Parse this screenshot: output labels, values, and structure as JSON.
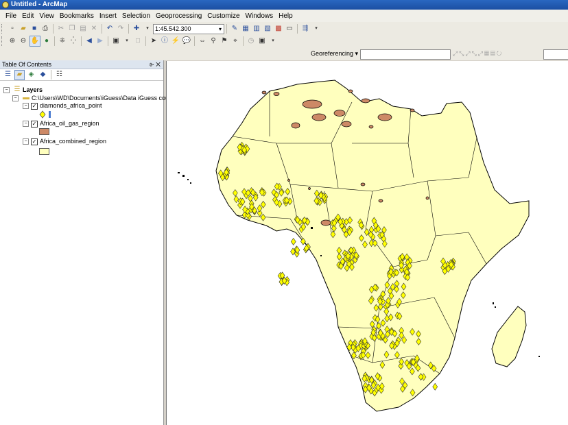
{
  "window": {
    "title": "Untitled - ArcMap"
  },
  "menu": [
    "File",
    "Edit",
    "View",
    "Bookmarks",
    "Insert",
    "Selection",
    "Geoprocessing",
    "Customize",
    "Windows",
    "Help"
  ],
  "toolbar": {
    "scale_value": "1:45.542.300"
  },
  "georef": {
    "label": "Georeferencing ▾"
  },
  "toc": {
    "title": "Table Of Contents",
    "header_controls": "⌱ ✕",
    "root": "Layers",
    "folder": "C:\\Users\\WD\\Documents\\iGuess\\Data iGuess cou",
    "layers": [
      {
        "name": "diamonds_africa_point",
        "checked": true,
        "color": "#ffff00"
      },
      {
        "name": "Africa_oil_gas_region",
        "checked": true,
        "color": "#cd8966"
      },
      {
        "name": "Africa_combined_region",
        "checked": true,
        "color": "#ffffbe"
      }
    ]
  },
  "colors": {
    "land": "#ffffbe",
    "oil": "#cd8966",
    "diamond": "#ffff00"
  }
}
